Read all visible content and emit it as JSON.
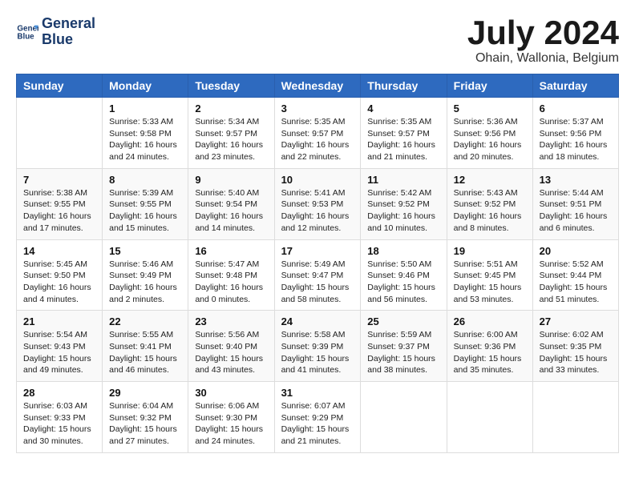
{
  "header": {
    "logo_line1": "General",
    "logo_line2": "Blue",
    "month_year": "July 2024",
    "location": "Ohain, Wallonia, Belgium"
  },
  "weekdays": [
    "Sunday",
    "Monday",
    "Tuesday",
    "Wednesday",
    "Thursday",
    "Friday",
    "Saturday"
  ],
  "weeks": [
    [
      {
        "day": "",
        "info": ""
      },
      {
        "day": "1",
        "info": "Sunrise: 5:33 AM\nSunset: 9:58 PM\nDaylight: 16 hours\nand 24 minutes."
      },
      {
        "day": "2",
        "info": "Sunrise: 5:34 AM\nSunset: 9:57 PM\nDaylight: 16 hours\nand 23 minutes."
      },
      {
        "day": "3",
        "info": "Sunrise: 5:35 AM\nSunset: 9:57 PM\nDaylight: 16 hours\nand 22 minutes."
      },
      {
        "day": "4",
        "info": "Sunrise: 5:35 AM\nSunset: 9:57 PM\nDaylight: 16 hours\nand 21 minutes."
      },
      {
        "day": "5",
        "info": "Sunrise: 5:36 AM\nSunset: 9:56 PM\nDaylight: 16 hours\nand 20 minutes."
      },
      {
        "day": "6",
        "info": "Sunrise: 5:37 AM\nSunset: 9:56 PM\nDaylight: 16 hours\nand 18 minutes."
      }
    ],
    [
      {
        "day": "7",
        "info": "Sunrise: 5:38 AM\nSunset: 9:55 PM\nDaylight: 16 hours\nand 17 minutes."
      },
      {
        "day": "8",
        "info": "Sunrise: 5:39 AM\nSunset: 9:55 PM\nDaylight: 16 hours\nand 15 minutes."
      },
      {
        "day": "9",
        "info": "Sunrise: 5:40 AM\nSunset: 9:54 PM\nDaylight: 16 hours\nand 14 minutes."
      },
      {
        "day": "10",
        "info": "Sunrise: 5:41 AM\nSunset: 9:53 PM\nDaylight: 16 hours\nand 12 minutes."
      },
      {
        "day": "11",
        "info": "Sunrise: 5:42 AM\nSunset: 9:52 PM\nDaylight: 16 hours\nand 10 minutes."
      },
      {
        "day": "12",
        "info": "Sunrise: 5:43 AM\nSunset: 9:52 PM\nDaylight: 16 hours\nand 8 minutes."
      },
      {
        "day": "13",
        "info": "Sunrise: 5:44 AM\nSunset: 9:51 PM\nDaylight: 16 hours\nand 6 minutes."
      }
    ],
    [
      {
        "day": "14",
        "info": "Sunrise: 5:45 AM\nSunset: 9:50 PM\nDaylight: 16 hours\nand 4 minutes."
      },
      {
        "day": "15",
        "info": "Sunrise: 5:46 AM\nSunset: 9:49 PM\nDaylight: 16 hours\nand 2 minutes."
      },
      {
        "day": "16",
        "info": "Sunrise: 5:47 AM\nSunset: 9:48 PM\nDaylight: 16 hours\nand 0 minutes."
      },
      {
        "day": "17",
        "info": "Sunrise: 5:49 AM\nSunset: 9:47 PM\nDaylight: 15 hours\nand 58 minutes."
      },
      {
        "day": "18",
        "info": "Sunrise: 5:50 AM\nSunset: 9:46 PM\nDaylight: 15 hours\nand 56 minutes."
      },
      {
        "day": "19",
        "info": "Sunrise: 5:51 AM\nSunset: 9:45 PM\nDaylight: 15 hours\nand 53 minutes."
      },
      {
        "day": "20",
        "info": "Sunrise: 5:52 AM\nSunset: 9:44 PM\nDaylight: 15 hours\nand 51 minutes."
      }
    ],
    [
      {
        "day": "21",
        "info": "Sunrise: 5:54 AM\nSunset: 9:43 PM\nDaylight: 15 hours\nand 49 minutes."
      },
      {
        "day": "22",
        "info": "Sunrise: 5:55 AM\nSunset: 9:41 PM\nDaylight: 15 hours\nand 46 minutes."
      },
      {
        "day": "23",
        "info": "Sunrise: 5:56 AM\nSunset: 9:40 PM\nDaylight: 15 hours\nand 43 minutes."
      },
      {
        "day": "24",
        "info": "Sunrise: 5:58 AM\nSunset: 9:39 PM\nDaylight: 15 hours\nand 41 minutes."
      },
      {
        "day": "25",
        "info": "Sunrise: 5:59 AM\nSunset: 9:37 PM\nDaylight: 15 hours\nand 38 minutes."
      },
      {
        "day": "26",
        "info": "Sunrise: 6:00 AM\nSunset: 9:36 PM\nDaylight: 15 hours\nand 35 minutes."
      },
      {
        "day": "27",
        "info": "Sunrise: 6:02 AM\nSunset: 9:35 PM\nDaylight: 15 hours\nand 33 minutes."
      }
    ],
    [
      {
        "day": "28",
        "info": "Sunrise: 6:03 AM\nSunset: 9:33 PM\nDaylight: 15 hours\nand 30 minutes."
      },
      {
        "day": "29",
        "info": "Sunrise: 6:04 AM\nSunset: 9:32 PM\nDaylight: 15 hours\nand 27 minutes."
      },
      {
        "day": "30",
        "info": "Sunrise: 6:06 AM\nSunset: 9:30 PM\nDaylight: 15 hours\nand 24 minutes."
      },
      {
        "day": "31",
        "info": "Sunrise: 6:07 AM\nSunset: 9:29 PM\nDaylight: 15 hours\nand 21 minutes."
      },
      {
        "day": "",
        "info": ""
      },
      {
        "day": "",
        "info": ""
      },
      {
        "day": "",
        "info": ""
      }
    ]
  ]
}
